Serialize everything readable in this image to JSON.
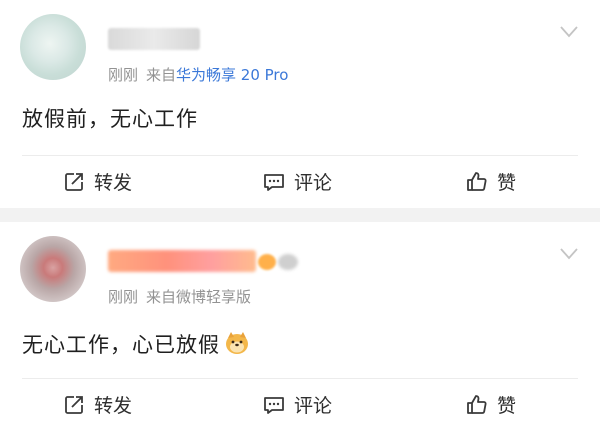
{
  "posts": [
    {
      "meta": {
        "time": "刚刚",
        "source_prefix": "来自",
        "device": "华为畅享 20 Pro"
      },
      "text": "放假前，无心工作",
      "actions": {
        "repost": "转发",
        "comment": "评论",
        "like": "赞"
      }
    },
    {
      "meta": {
        "time": "刚刚",
        "source_prefix": "来自",
        "device": "微博轻享版"
      },
      "text": "无心工作，心已放假",
      "actions": {
        "repost": "转发",
        "comment": "评论",
        "like": "赞"
      }
    }
  ],
  "icons": {
    "more": "chevron-down-icon",
    "repost": "repost-icon",
    "comment": "comment-icon",
    "like": "thumbs-up-icon",
    "emoji": "doge-emoji-icon"
  },
  "colors": {
    "link": "#3b78d8",
    "meta": "#939393",
    "separator": "#f2f2f2"
  }
}
